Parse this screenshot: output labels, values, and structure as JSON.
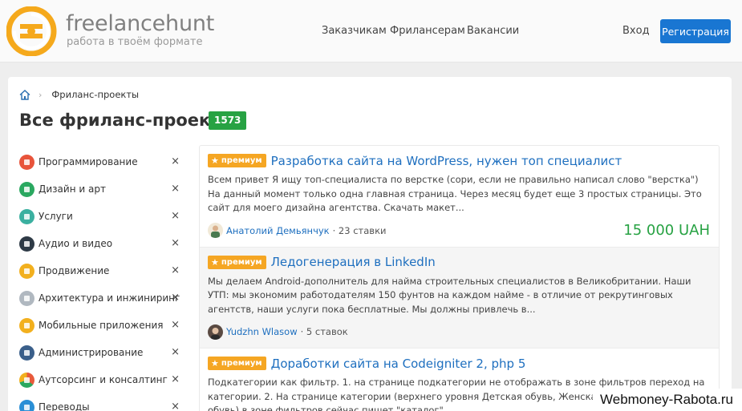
{
  "header": {
    "brand_name": "freelancehunt",
    "brand_tagline": "работа в твоём формате",
    "nav": [
      {
        "label": "Заказчикам"
      },
      {
        "label": "Фрилансерам"
      },
      {
        "label": "Вакансии"
      }
    ],
    "login_label": "Вход",
    "register_label": "Регистрация",
    "accent_color": "#1976d2"
  },
  "breadcrumb": {
    "home_icon": "home-icon",
    "current": "Фриланс-проекты"
  },
  "page": {
    "title": "Все фриланс-проекты",
    "count": "1573"
  },
  "categories": [
    {
      "label": "Программирование",
      "icon": "code-icon",
      "color": "#e8543b"
    },
    {
      "label": "Дизайн и арт",
      "icon": "palette-icon",
      "color": "#2aa860"
    },
    {
      "label": "Услуги",
      "icon": "cup-icon",
      "color": "#3bb0a0"
    },
    {
      "label": "Аудио и видео",
      "icon": "clapper-icon",
      "color": "#2e3a46"
    },
    {
      "label": "Продвижение",
      "icon": "megaphone-icon",
      "color": "#f2b01e"
    },
    {
      "label": "Архитектура и инжиниринг",
      "icon": "cube-icon",
      "color": "#b0b8c0"
    },
    {
      "label": "Мобильные приложения",
      "icon": "phone-icon",
      "color": "#f2b01e"
    },
    {
      "label": "Администрирование",
      "icon": "server-icon",
      "color": "#3a5f8a"
    },
    {
      "label": "Аутсорсинг и консалтинг",
      "icon": "chart-pie-icon",
      "color": "#e85a3b"
    },
    {
      "label": "Переводы",
      "icon": "translate-icon",
      "color": "#2a8fd6"
    }
  ],
  "remove_symbol": "×",
  "premium_label": "премиум",
  "projects": [
    {
      "title": "Разработка сайта на WordPress, нужен топ специалист",
      "description": "Всем привет Я ищу топ-специалиста по верстке (сори, если не правильно написал слово \"верстка\") На данный момент только одна главная страница. Через месяц будет еще 3 простых страницы. Это сайт для моего дизайна агентства. Скачать макет...",
      "author": "Анатолий Демьянчук",
      "bids": "· 23 ставки",
      "price": "15 000 UAH"
    },
    {
      "title": "Ледогенерация в LinkedIn",
      "description": "Мы делаем Android-дополнитель для найма строительных специалистов в Великобритании. Наши УТП: мы экономим работодателям 150 фунтов на каждом найме - в отличие от рекрутинговых агентств, наши услуги пока бесплатные. Мы должны привлечь в...",
      "author": "Yudzhn Wlasow",
      "bids": "· 5 ставок",
      "price": ""
    },
    {
      "title": "Доработки сайта на Codeigniter 2, php 5",
      "description": "Подкатегории как фильтр. 1. на странице подкатегории не отображать в зоне фильтров переход на категории. 2. На странице категории (верхнего уровня Детская обувь, Женская обувь, Мужская обувь) в зоне фильтров сейчас пишет \"каталог\"...",
      "author": "",
      "bids": "",
      "price": ""
    }
  ],
  "watermark": "Webmoney-Rabota.ru",
  "colors": {
    "premium": "#f5a623",
    "link": "#1e6fbf",
    "price": "#27a243",
    "badge": "#27a243"
  }
}
